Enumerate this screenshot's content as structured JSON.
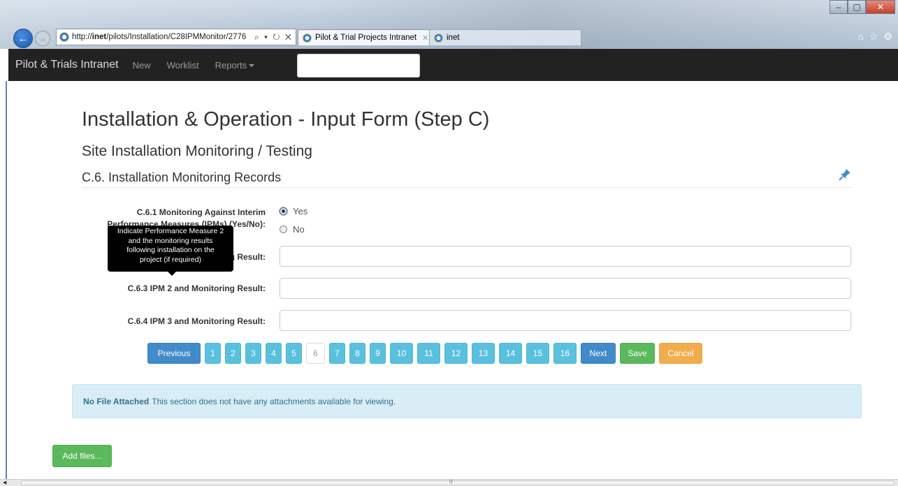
{
  "browser": {
    "url_prefix": "http://",
    "url_host": "inet",
    "url_path": "/pilots/Installation/C28IPMMonitor/2776",
    "address_tools": "⌕ ▾ ↻ ✕",
    "tabs": [
      {
        "label": "Pilot & Trial Projects Intranet",
        "active": true
      },
      {
        "label": "inet",
        "active": false
      }
    ]
  },
  "navbar": {
    "brand": "Pilot & Trials Intranet",
    "links": [
      "New",
      "Worklist",
      "Reports"
    ],
    "search_value": ""
  },
  "page": {
    "title": "Installation & Operation - Input Form (Step C)",
    "subtitle": "Site Installation Monitoring / Testing",
    "section": "C.6. Installation Monitoring Records"
  },
  "form": {
    "q1_label_line1": "C.6.1 Monitoring Against Interim",
    "q1_label_line2": "Performance Measures (IPMs) (Yes/No):",
    "q1_options": [
      "Yes",
      "No"
    ],
    "q1_selected": "Yes",
    "q2_label": "C.6.2 IPM 1 and Monitoring Result:",
    "q3_label": "C.6.3 IPM 2 and Monitoring Result:",
    "q4_label": "C.6.4 IPM 3 and Monitoring Result:",
    "q2_value": "",
    "q3_value": "",
    "q4_value": ""
  },
  "tooltip": {
    "lines": [
      "Indicate Performance Measure 2",
      "and the monitoring results",
      "following installation on the",
      "project (if required)"
    ]
  },
  "pagination": {
    "previous": "Previous",
    "pages": [
      "1",
      "2",
      "3",
      "4",
      "5",
      "6",
      "7",
      "8",
      "9",
      "10",
      "11",
      "12",
      "13",
      "14",
      "15",
      "16"
    ],
    "current": "6",
    "next": "Next",
    "save": "Save",
    "cancel": "Cancel"
  },
  "attachments": {
    "title": "No File Attached",
    "message": "This section does not have any attachments available for viewing."
  },
  "add_files_label": "Add files...",
  "colors": {
    "primary": "#428bca",
    "info": "#5bc0de",
    "success": "#5cb85c",
    "warning": "#f0ad4e",
    "navbar": "#222222",
    "alert_bg": "#d9edf7"
  }
}
